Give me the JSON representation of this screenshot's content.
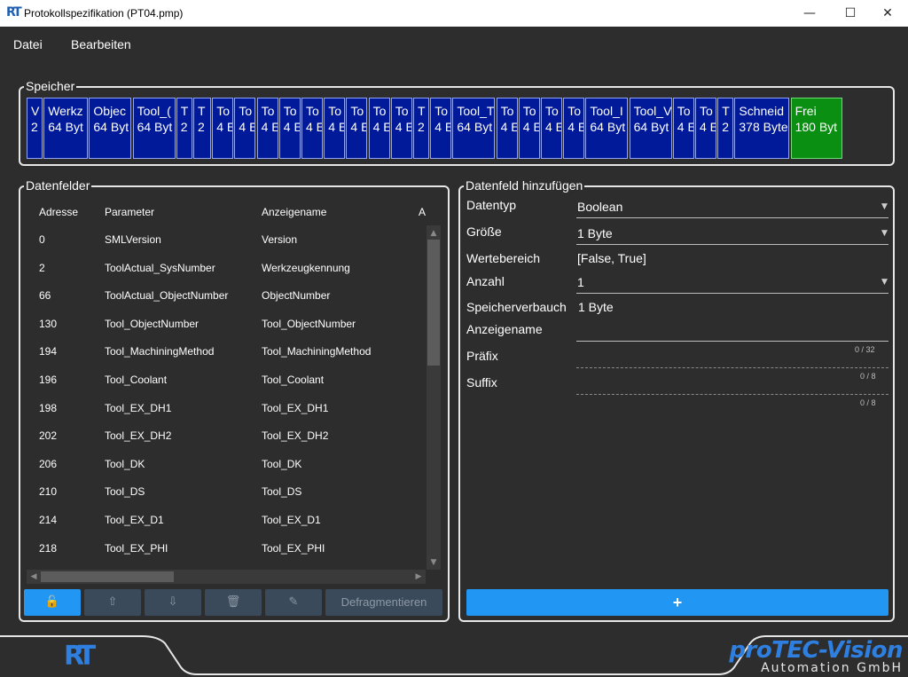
{
  "window": {
    "title": "Protokollspezifikation (PT04.pmp)",
    "icon": "RT",
    "minimize": "—",
    "maximize": "☐",
    "close": "✕"
  },
  "menu": {
    "file": "Datei",
    "edit": "Bearbeiten"
  },
  "memory": {
    "label": "Speicher",
    "blocks": [
      {
        "text": "V\n2"
      },
      {
        "text": "Werkz\n64 Byt"
      },
      {
        "text": "Objec\n64 Byt"
      },
      {
        "text": "Tool_(\n64 Byt"
      },
      {
        "text": "T\n2"
      },
      {
        "text": "T\n2"
      },
      {
        "text": "To\n4 E"
      },
      {
        "text": "To\n4 E"
      },
      {
        "text": "To\n4 E"
      },
      {
        "text": "To\n4 E"
      },
      {
        "text": "To\n4 E"
      },
      {
        "text": "To\n4 E"
      },
      {
        "text": "To\n4 E"
      },
      {
        "text": "To\n4 E"
      },
      {
        "text": "To\n4 E"
      },
      {
        "text": "T\n2"
      },
      {
        "text": "To\n4 E"
      },
      {
        "text": "Tool_T\n64 Byt"
      },
      {
        "text": "To\n4 E"
      },
      {
        "text": "To\n4 E"
      },
      {
        "text": "To\n4 E"
      },
      {
        "text": "To\n4 E"
      },
      {
        "text": "Tool_I\n64 Byt"
      },
      {
        "text": "Tool_V\n64 Byt"
      },
      {
        "text": "To\n4 E"
      },
      {
        "text": "To\n4 E"
      },
      {
        "text": "T\n2"
      },
      {
        "text": "Schneid\n378 Byte"
      },
      {
        "text": "Frei\n180 Byt",
        "free": true
      }
    ]
  },
  "datafields": {
    "label": "Datenfelder",
    "columns": [
      "Adresse",
      "Parameter",
      "Anzeigename",
      "A"
    ],
    "rows": [
      [
        "0",
        "SMLVersion",
        "Version"
      ],
      [
        "2",
        "ToolActual_SysNumber",
        "Werkzeugkennung"
      ],
      [
        "66",
        "ToolActual_ObjectNumber",
        "ObjectNumber"
      ],
      [
        "130",
        "Tool_ObjectNumber",
        "Tool_ObjectNumber"
      ],
      [
        "194",
        "Tool_MachiningMethod",
        "Tool_MachiningMethod"
      ],
      [
        "196",
        "Tool_Coolant",
        "Tool_Coolant"
      ],
      [
        "198",
        "Tool_EX_DH1",
        "Tool_EX_DH1"
      ],
      [
        "202",
        "Tool_EX_DH2",
        "Tool_EX_DH2"
      ],
      [
        "206",
        "Tool_DK",
        "Tool_DK"
      ],
      [
        "210",
        "Tool_DS",
        "Tool_DS"
      ],
      [
        "214",
        "Tool_EX_D1",
        "Tool_EX_D1"
      ],
      [
        "218",
        "Tool_EX_PHI",
        "Tool_EX_PHI"
      ]
    ],
    "buttons": {
      "lock": "🔓",
      "up": "⇧",
      "down": "⇩",
      "delete": "🗑",
      "edit": "✎",
      "defrag": "Defragmentieren"
    }
  },
  "addfield": {
    "label": "Datenfeld hinzufügen",
    "datatype_label": "Datentyp",
    "datatype_value": "Boolean",
    "size_label": "Größe",
    "size_value": "1 Byte",
    "range_label": "Wertebereich",
    "range_value": "[False, True]",
    "count_label": "Anzahl",
    "count_value": "1",
    "usage_label": "Speicherverbauch",
    "usage_value": "1 Byte",
    "displayname_label": "Anzeigename",
    "displayname_counter": "0 / 32",
    "prefix_label": "Präfix",
    "prefix_counter": "0 / 8",
    "suffix_label": "Suffix",
    "suffix_counter": "0 / 8",
    "add_button": "+"
  },
  "footer": {
    "logo": "RT",
    "brand": "proTEC-Vision",
    "brand_sub": "Automation GmbH"
  },
  "colors": {
    "background": "#2d2d2d",
    "memory_block": "#001a9a",
    "memory_free": "#0a8f13",
    "accent": "#2196f3",
    "brand": "#2f7fe0"
  }
}
